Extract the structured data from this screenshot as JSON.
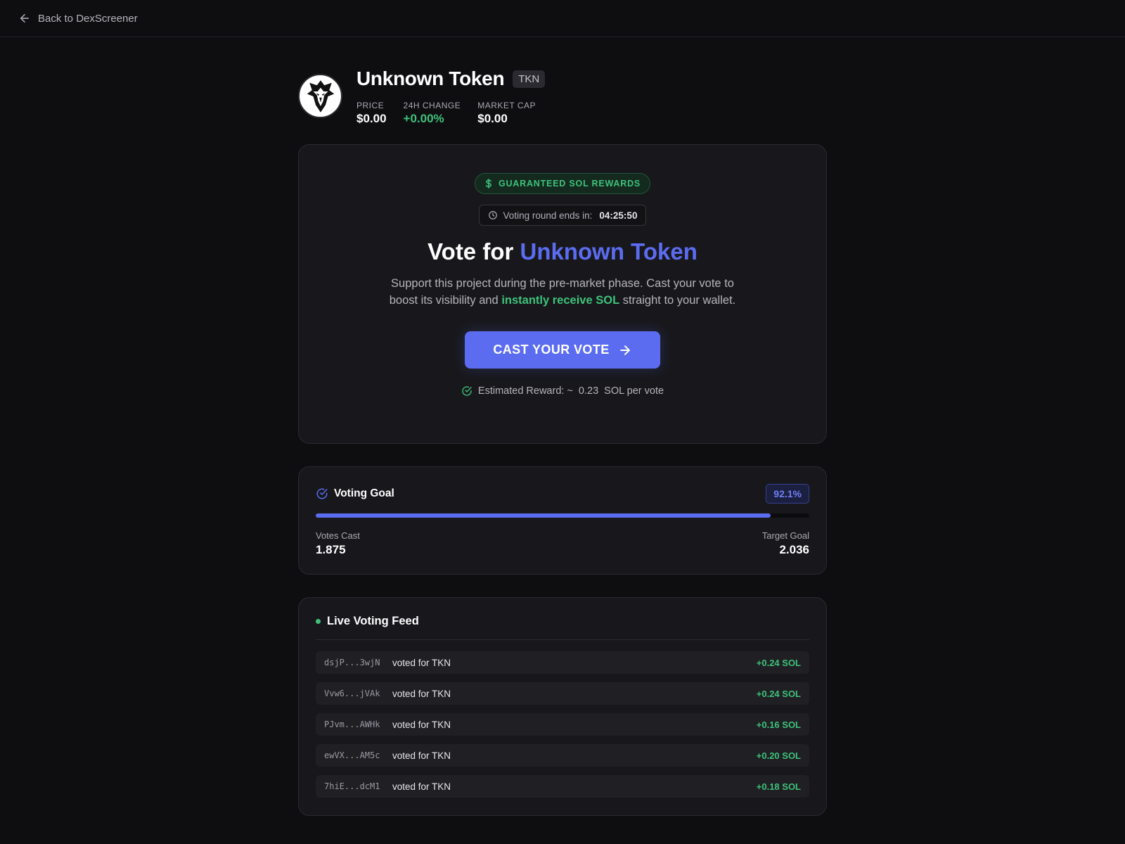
{
  "nav": {
    "back_label": "Back to DexScreener"
  },
  "token": {
    "name": "Unknown Token",
    "ticker": "TKN",
    "stats": [
      {
        "label": "PRICE",
        "value": "$0.00",
        "color": "#ffffff"
      },
      {
        "label": "24H CHANGE",
        "value": "+0.00%",
        "color": "#3ec27a"
      },
      {
        "label": "MARKET CAP",
        "value": "$0.00",
        "color": "#ffffff"
      }
    ]
  },
  "vote": {
    "rewards_badge": "GUARANTEED SOL REWARDS",
    "timer_label": "Voting round ends in:",
    "timer_value": "04:25:50",
    "title_prefix": "Vote for",
    "title_token": "Unknown Token",
    "desc_part1": "Support this project during the pre-market phase. Cast your vote to boost its visibility and",
    "desc_highlight": "instantly receive SOL",
    "desc_part2": "straight to your wallet.",
    "cta_label": "CAST YOUR VOTE",
    "estimate_prefix": "Estimated Reward: ~",
    "estimate_value": "0.23",
    "estimate_suffix": "SOL per vote"
  },
  "goal": {
    "title": "Voting Goal",
    "percent_label": "92.1%",
    "progress_fraction": 0.921,
    "votes_cast_label": "Votes Cast",
    "votes_cast_value": "1.875",
    "target_label": "Target Goal",
    "target_value": "2.036"
  },
  "feed": {
    "title": "Live Voting Feed",
    "rows": [
      {
        "address": "dsjP...3wjN",
        "action": "voted for TKN",
        "amount": "+0.24 SOL"
      },
      {
        "address": "Vvw6...jVAk",
        "action": "voted for TKN",
        "amount": "+0.24 SOL"
      },
      {
        "address": "PJvm...AWHk",
        "action": "voted for TKN",
        "amount": "+0.16 SOL"
      },
      {
        "address": "ewVX...AM5c",
        "action": "voted for TKN",
        "amount": "+0.20 SOL"
      },
      {
        "address": "7hiE...dcM1",
        "action": "voted for TKN",
        "amount": "+0.18 SOL"
      }
    ]
  },
  "colors": {
    "accent": "#5b6cf0",
    "success": "#3ec27a",
    "background": "#0e0e11",
    "card": "#18181c"
  },
  "icons": {
    "back": "arrow-left-icon",
    "logo": "eagle-logo",
    "rewards": "dollar-icon",
    "timer": "clock-icon",
    "cta": "arrow-right-icon",
    "estimate": "check-circle-icon",
    "goal": "check-circle-icon"
  }
}
